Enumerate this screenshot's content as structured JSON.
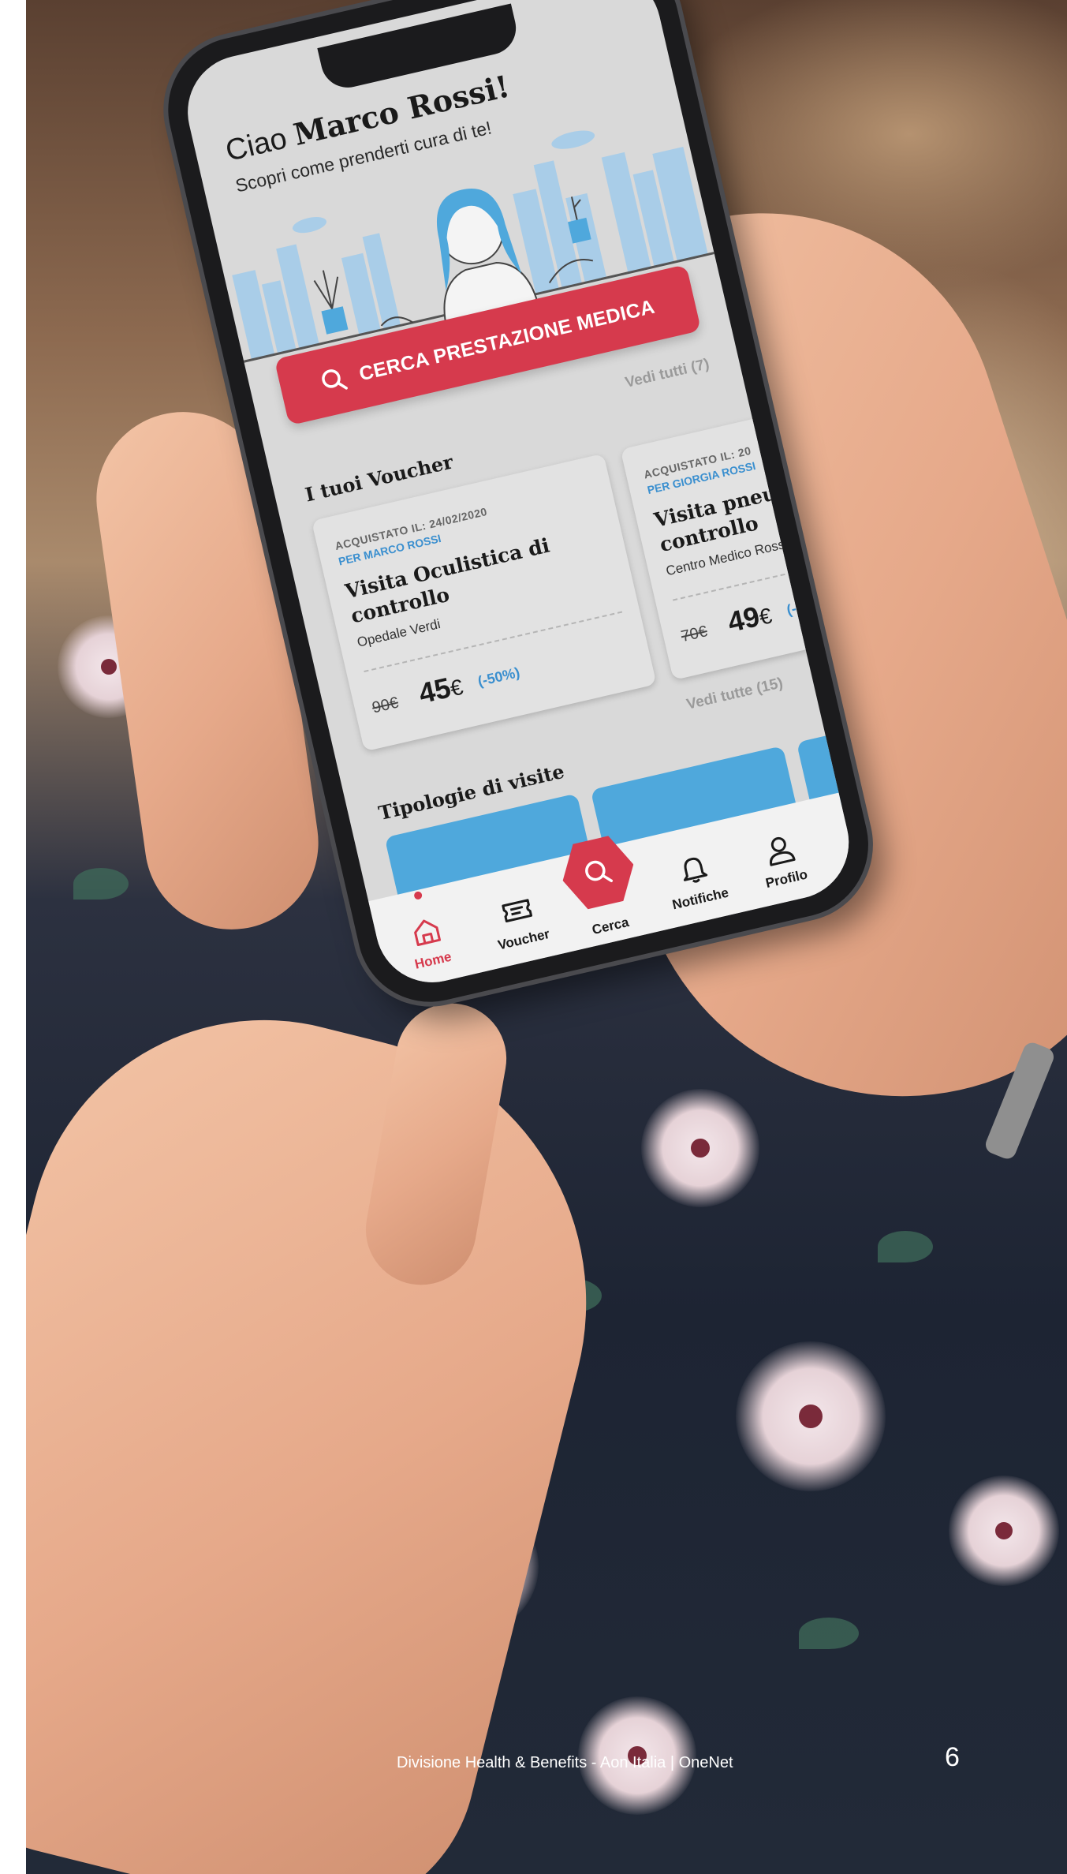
{
  "app": {
    "greeting_prefix": "Ciao",
    "user_name": "Marco Rossi!",
    "subtitle": "Scopri come prenderti cura di te!",
    "search_cta": "CERCA PRESTAZIONE MEDICA",
    "colors": {
      "brand_red": "#d63a4d",
      "accent_blue": "#3a8fcf",
      "tile_blue": "#4fa8dc"
    }
  },
  "vouchers": {
    "title": "I tuoi Voucher",
    "see_all": "Vedi tutti (7)",
    "items": [
      {
        "purchased": "ACQUISTATO IL: 24/02/2020",
        "for": "PER MARCO ROSSI",
        "name": "Visita Oculistica di controllo",
        "place": "Opedale Verdi",
        "old_price": "90€",
        "price": "45",
        "currency": "€",
        "discount": "(-50%)"
      },
      {
        "purchased": "ACQUISTATO IL: 20",
        "for": "PER GIORGIA ROSSI",
        "name": "Visita pneumo controllo",
        "place": "Centro Medico Ross",
        "old_price": "70€",
        "price": "49",
        "currency": "€",
        "discount": "(-"
      }
    ]
  },
  "visit_types": {
    "title": "Tipologie di visite",
    "see_all": "Vedi tutte (15)"
  },
  "tabbar": {
    "home": {
      "label": "Home",
      "icon": "home-icon"
    },
    "voucher": {
      "label": "Voucher",
      "icon": "ticket-icon"
    },
    "search": {
      "label": "Cerca",
      "icon": "search-icon"
    },
    "notifications": {
      "label": "Notifiche",
      "icon": "bell-icon"
    },
    "profile": {
      "label": "Profilo",
      "icon": "user-icon"
    }
  },
  "footer": {
    "text": "Divisione Health & Benefits - Aon Italia |  OneNet",
    "page": "6"
  }
}
